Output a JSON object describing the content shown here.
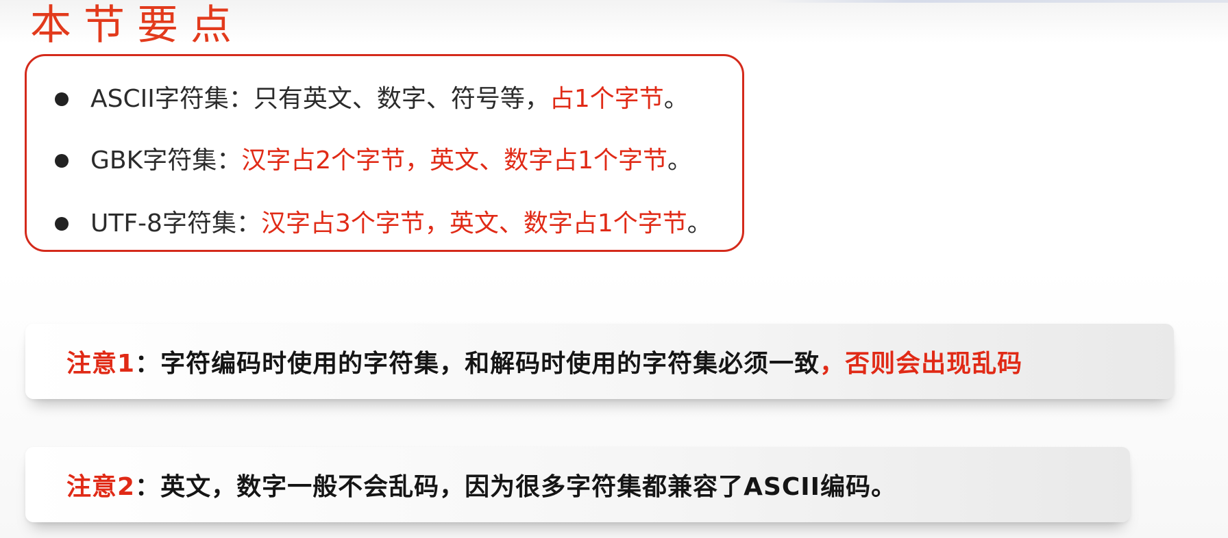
{
  "title": "本节要点",
  "key_points": [
    {
      "prefix": "ASCII字符集：只有英文、数字、符号等，",
      "highlight": "占1个字节",
      "suffix": "。"
    },
    {
      "prefix": "GBK字符集：",
      "highlight": "汉字占2个字节，英文、数字占1个字节",
      "suffix": "。"
    },
    {
      "prefix": "UTF-8字符集：",
      "highlight": "汉字占3个字节，英文、数字占1个字节",
      "suffix": "。"
    }
  ],
  "notes": [
    {
      "label": "注意1",
      "separator": "：",
      "text": "字符编码时使用的字符集，和解码时使用的字符集必须一致",
      "highlight": "，否则会出现乱码"
    },
    {
      "label": "注意2",
      "separator": "：",
      "text": "英文，数字一般不会乱码，因为很多字符集都兼容了ASCII编码。",
      "highlight": ""
    }
  ],
  "colors": {
    "accent_red": "#e02a16",
    "border_red": "#d42a1b",
    "text_dark": "#2b2b2b"
  }
}
